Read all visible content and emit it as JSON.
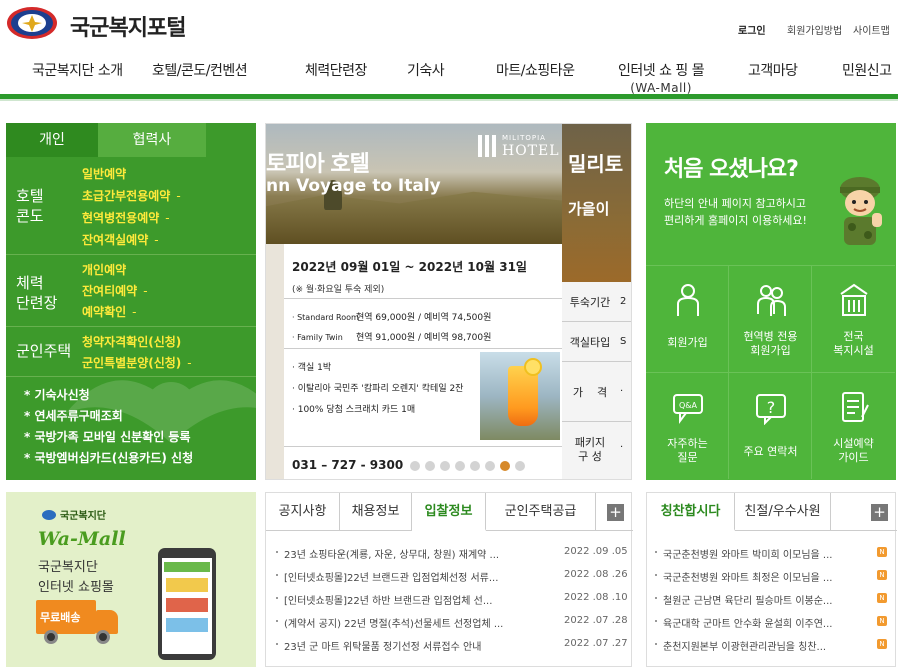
{
  "header": {
    "site_title": "국군복지포털",
    "login": "로그인",
    "join_guide": "회원가입방법",
    "sitemap": "사이트맵",
    "nav": [
      {
        "label": "국군복지단 소개"
      },
      {
        "label": "호텔/콘도/컨벤션"
      },
      {
        "label": "체력단련장"
      },
      {
        "label": "기숙사"
      },
      {
        "label": "마트/쇼핑타운"
      },
      {
        "label": "인터넷 쇼 핑 몰",
        "sub": "(WA-Mall)"
      },
      {
        "label": "고객마당"
      },
      {
        "label": "민원신고"
      }
    ]
  },
  "left_panel": {
    "tabs": [
      "개인",
      "협력사"
    ],
    "groups": [
      {
        "category": "호텔\n콘도",
        "links": [
          "일반예약",
          "초급간부전용예약",
          "현역병전용예약",
          "잔여객실예약"
        ]
      },
      {
        "category": "체력\n단련장",
        "links": [
          "개인예약",
          "잔여티예약",
          "예약확인"
        ]
      },
      {
        "category": "군인주택",
        "links": [
          "청약자격확인(신청)",
          "군인특별분양(신청)"
        ]
      }
    ],
    "dash": "-",
    "bottom_links": [
      "* 기숙사신청",
      "* 연세주류구매조회",
      "* 국방가족 모바일 신분확인 등록",
      "* 국방엠버십카드(신용카드) 신청"
    ]
  },
  "banner": {
    "hotel_name": "토피아 호텔",
    "voyage": "nn Voyage to Italy",
    "brand_small": "MILITOPIA",
    "brand_big": "HOTEL",
    "right_title": "밀리토",
    "right_sub": "가을이 ",
    "date": "2022년 09월 01일 ~ 2022년 10월 31일",
    "note": "(※ 월·화요일 투숙 제외)",
    "rooms": [
      {
        "name": "· Standard Room",
        "price": "현역 69,000원 / 예비역 74,500원"
      },
      {
        "name": "· Family Twin",
        "price": "현역 91,000원 / 예비역 98,700원"
      }
    ],
    "benefits": [
      "· 객실 1박",
      "· 이탈리아 국민주 '캄파리 오렌지' 칵테일 2잔",
      "· 100% 당첨 스크래치 카드 1매"
    ],
    "phone": "031 – 727 - 9300",
    "dots_total": 8,
    "dots_active": 7,
    "info_rows": [
      {
        "label": "투숙기간",
        "value": "2"
      },
      {
        "label": "객실타입",
        "value": "S"
      },
      {
        "label": "가    격",
        "value": "·"
      },
      {
        "label": "패키지\n구  성",
        "value": "·"
      }
    ]
  },
  "welcome": {
    "title": "처음 오셨나요?",
    "desc": "하단의 안내 페이지 참고하시고\n편리하게 홈페이지 이용하세요!",
    "items": [
      {
        "label": "회원가입",
        "icon": "person-icon"
      },
      {
        "label": "현역병 전용\n회원가입",
        "icon": "soldiers-icon"
      },
      {
        "label": "전국\n복지시설",
        "icon": "building-icon"
      },
      {
        "label": "자주하는\n질문",
        "icon": "qa-icon"
      },
      {
        "label": "주요 연락처",
        "icon": "question-icon"
      },
      {
        "label": "시설예약\n가이드",
        "icon": "notebook-icon"
      }
    ]
  },
  "wamall": {
    "brand": "국군복지단",
    "logo": "Wa-Mall",
    "text": "국군복지단\n인터넷 쇼핑몰",
    "free": "무료배송"
  },
  "notice": {
    "tabs": [
      "공지사항",
      "채용정보",
      "입찰정보",
      "군인주택공급"
    ],
    "active_tab": 2,
    "plus": "+",
    "rows": [
      {
        "title": "23년 쇼핑타운(계룡, 자운, 상무대, 창원) 재계약 ...",
        "date": "2022 .09 .05"
      },
      {
        "title": "[인터넷쇼핑몰]22년 브랜드관 입점업체선정 서류...",
        "date": "2022 .08 .26"
      },
      {
        "title": "[인터넷쇼핑몰]22년 하반 브랜드관 입점업체 선...",
        "date": "2022 .08 .10"
      },
      {
        "title": "(계약서 공지) 22년 명절(추석)선물세트 선정업체 ...",
        "date": "2022 .07 .28"
      },
      {
        "title": "23년 군 마트 위탁물품 정기선정 서류접수 안내",
        "date": "2022 .07 .27"
      }
    ]
  },
  "praise": {
    "tabs": [
      "칭찬합시다",
      "친절/우수사원"
    ],
    "plus": "+",
    "new_badge": "N",
    "rows": [
      "국군춘천병원 와마트 박미희 이모님을 ...",
      "국군춘천병원 와마트 최정은 이모님을 ...",
      "철원군 근남면 육단리 필승마트 이봉순...",
      "육군대학 군마트 안수화 윤설희 이주연...",
      "춘천지원본부 이광현관리관님을 칭찬..."
    ]
  }
}
